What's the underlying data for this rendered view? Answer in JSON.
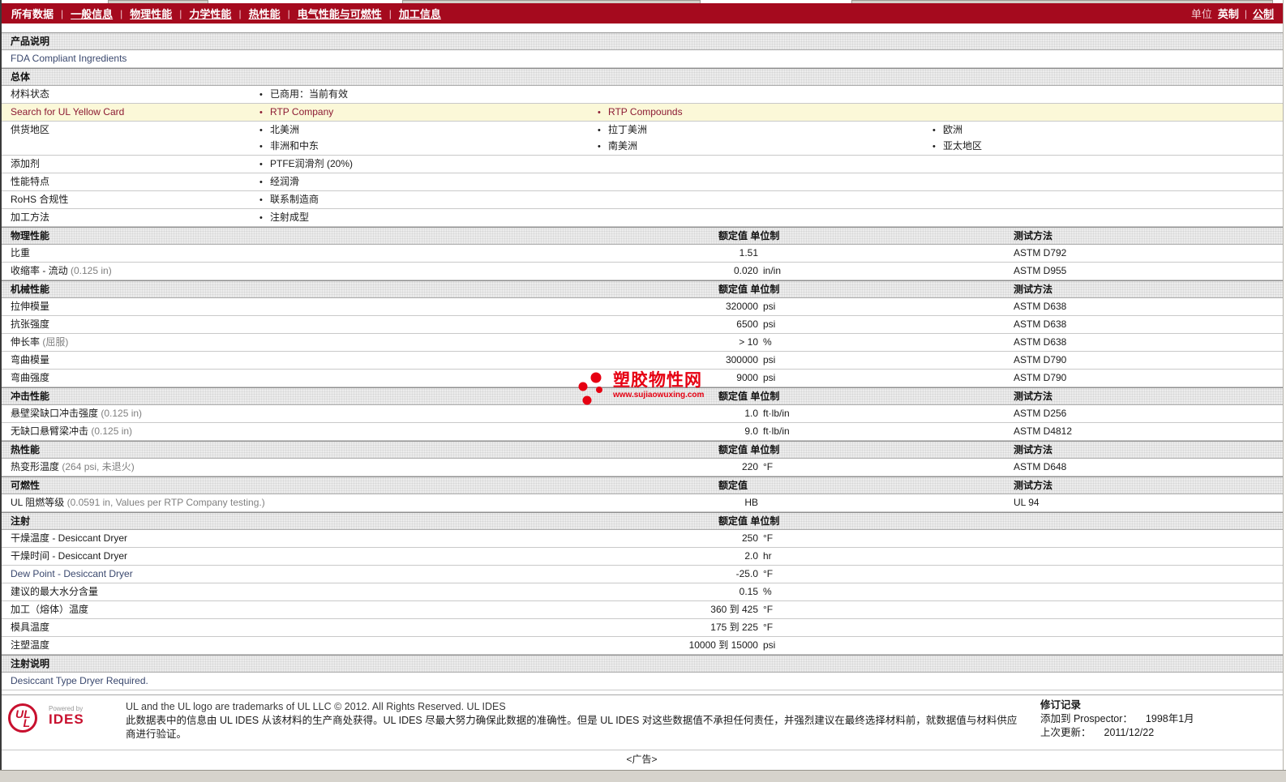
{
  "nav": {
    "items": [
      {
        "label": "所有数据",
        "active": true
      },
      {
        "label": "一般信息"
      },
      {
        "label": "物理性能"
      },
      {
        "label": "力学性能"
      },
      {
        "label": "热性能"
      },
      {
        "label": "电气性能与可燃性"
      },
      {
        "label": "加工信息"
      }
    ],
    "units_label": "单位",
    "unit_imperial": "英制",
    "unit_metric": "公制"
  },
  "colors": {
    "nav_red": "#A50A1E",
    "highlight_yellow": "#FBF8D8",
    "maroon_link": "#8C1B33",
    "watermark_red": "#E60012",
    "ul_logo_red": "#C8102E"
  },
  "watermark": {
    "title": "塑胶物性网",
    "subtitle": "www.sujiaowuxing.com"
  },
  "blocks": [
    {
      "type": "header",
      "label": "产品说明"
    },
    {
      "type": "text",
      "text": "FDA Compliant Ingredients",
      "navy": true
    },
    {
      "type": "header",
      "label": "总体"
    },
    {
      "type": "bullets",
      "label": "材料状态",
      "cols": [
        [
          "已商用：当前有效"
        ]
      ]
    },
    {
      "type": "bullets",
      "label": "Search for UL Yellow Card",
      "highlight": true,
      "links": true,
      "cols": [
        [
          "RTP Company"
        ],
        [
          "RTP Compounds"
        ]
      ]
    },
    {
      "type": "bullets",
      "label": "供货地区",
      "cols": [
        [
          "北美洲",
          "非洲和中东"
        ],
        [
          "拉丁美洲",
          "南美洲"
        ],
        [
          "欧洲",
          "亚太地区"
        ]
      ]
    },
    {
      "type": "bullets",
      "label": "添加剂",
      "cols": [
        [
          "PTFE润滑剂  (20%)"
        ]
      ]
    },
    {
      "type": "bullets",
      "label": "性能特点",
      "cols": [
        [
          "经润滑"
        ]
      ]
    },
    {
      "type": "bullets",
      "label": "RoHS 合规性",
      "cols": [
        [
          "联系制造商"
        ]
      ]
    },
    {
      "type": "bullets",
      "label": "加工方法",
      "cols": [
        [
          "注射成型"
        ]
      ]
    },
    {
      "type": "header",
      "label": "物理性能",
      "value_header": "额定值 单位制",
      "method_header": "测试方法"
    },
    {
      "type": "prop",
      "label": "比重",
      "value": "1.51",
      "method": "ASTM D792"
    },
    {
      "type": "prop",
      "label": "收缩率  - 流动",
      "cond": "(0.125 in)",
      "value": "0.020",
      "unit": "in/in",
      "method": "ASTM D955"
    },
    {
      "type": "header",
      "label": "机械性能",
      "value_header": "额定值 单位制",
      "method_header": "测试方法"
    },
    {
      "type": "prop",
      "label": "拉伸模量",
      "value": "320000",
      "unit": "psi",
      "method": "ASTM D638"
    },
    {
      "type": "prop",
      "label": "抗张强度",
      "value": "6500",
      "unit": "psi",
      "method": "ASTM D638"
    },
    {
      "type": "prop",
      "label": "伸长率",
      "cond": "(屈服)",
      "value": "> 10",
      "unit": "%",
      "method": "ASTM D638"
    },
    {
      "type": "prop",
      "label": "弯曲模量",
      "value": "300000",
      "unit": "psi",
      "method": "ASTM D790"
    },
    {
      "type": "prop",
      "label": "弯曲强度",
      "value": "9000",
      "unit": "psi",
      "method": "ASTM D790"
    },
    {
      "type": "header",
      "label": "冲击性能",
      "value_header": "额定值 单位制",
      "method_header": "测试方法"
    },
    {
      "type": "prop",
      "label": "悬壁梁缺口冲击强度",
      "cond": "(0.125 in)",
      "value": "1.0",
      "unit": "ft·lb/in",
      "method": "ASTM D256"
    },
    {
      "type": "prop",
      "label": "无缺口悬臂梁冲击",
      "cond": "(0.125 in)",
      "value": "9.0",
      "unit": "ft·lb/in",
      "method": "ASTM D4812"
    },
    {
      "type": "header",
      "label": "热性能",
      "value_header": "额定值 单位制",
      "method_header": "测试方法"
    },
    {
      "type": "prop",
      "label": "热变形温度",
      "cond": "(264 psi, 未退火)",
      "value": "220",
      "unit": "°F",
      "method": "ASTM D648"
    },
    {
      "type": "header",
      "label": "可燃性",
      "value_header": "额定值",
      "method_header": "测试方法"
    },
    {
      "type": "prop",
      "label": "UL 阻燃等级",
      "cond": "(0.0591 in, Values per RTP Company testing.)",
      "value": "HB",
      "method": "UL 94"
    },
    {
      "type": "header",
      "label": "注射",
      "value_header": "额定值 单位制"
    },
    {
      "type": "prop",
      "label": "干燥温度  - Desiccant Dryer",
      "value": "250",
      "unit": "°F"
    },
    {
      "type": "prop",
      "label": "干燥时间  - Desiccant Dryer",
      "value": "2.0",
      "unit": "hr"
    },
    {
      "type": "prop",
      "label": "Dew Point - Desiccant Dryer",
      "navy": true,
      "value": "-25.0",
      "unit": "°F"
    },
    {
      "type": "prop",
      "label": "建议的最大水分含量",
      "value": "0.15",
      "unit": "%"
    },
    {
      "type": "prop",
      "label": "加工（熔体）温度",
      "value": "360 到 425",
      "unit": "°F"
    },
    {
      "type": "prop",
      "label": "模具温度",
      "value": "175 到 225",
      "unit": "°F"
    },
    {
      "type": "prop",
      "label": "注塑温度",
      "value": "10000 到 15000",
      "unit": "psi"
    },
    {
      "type": "header",
      "label": "注射说明"
    },
    {
      "type": "text",
      "text": "Desiccant Type Dryer Required.",
      "navy": true
    }
  ],
  "footer": {
    "logo": {
      "ul": "UL",
      "powered_by": "Powered by",
      "ides": "IDES"
    },
    "legal_en": "UL and the UL logo are trademarks of UL LLC © 2012. All Rights Reserved. UL IDES",
    "legal_zh": "此数据表中的信息由 UL IDES 从该材料的生产商处获得。UL IDES 尽最大努力确保此数据的准确性。但是 UL IDES 对这些数据值不承担任何责任，并强烈建议在最终选择材料前，就数据值与材料供应商进行验证。",
    "revision": {
      "title": "修订记录",
      "added_label": "添加到  Prospector：",
      "added_value": "1998年1月",
      "updated_label": "上次更新：",
      "updated_value": "2011/12/22"
    }
  },
  "ad_text": "<广告>"
}
